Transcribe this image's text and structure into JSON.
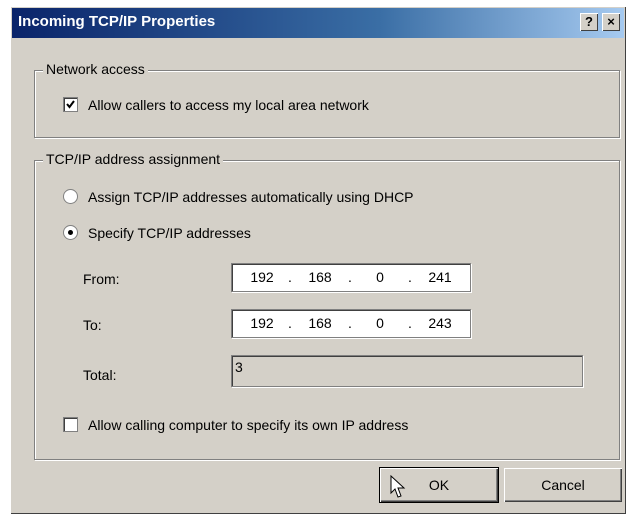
{
  "window": {
    "title": "Incoming TCP/IP Properties",
    "help_label": "?",
    "close_label": "×"
  },
  "network_access": {
    "legend": "Network access",
    "allow_callers_label": "Allow callers to access my local area network",
    "allow_callers_checked": true
  },
  "tcpip": {
    "legend": "TCP/IP address assignment",
    "dhcp_option_label": "Assign TCP/IP addresses automatically using DHCP",
    "specify_option_label": "Specify TCP/IP addresses",
    "selected_option": "specify",
    "from_label": "From:",
    "from_octets": [
      "192",
      "168",
      "0",
      "241"
    ],
    "to_label": "To:",
    "to_octets": [
      "192",
      "168",
      "0",
      "243"
    ],
    "total_label": "Total:",
    "total_value": "3",
    "allow_own_ip_label": "Allow calling computer to specify its own IP address",
    "allow_own_ip_checked": false
  },
  "buttons": {
    "ok_label": "OK",
    "cancel_label": "Cancel"
  },
  "icons": {
    "cursor": "arrow-cursor-icon",
    "checkmark": "checkmark-icon"
  }
}
